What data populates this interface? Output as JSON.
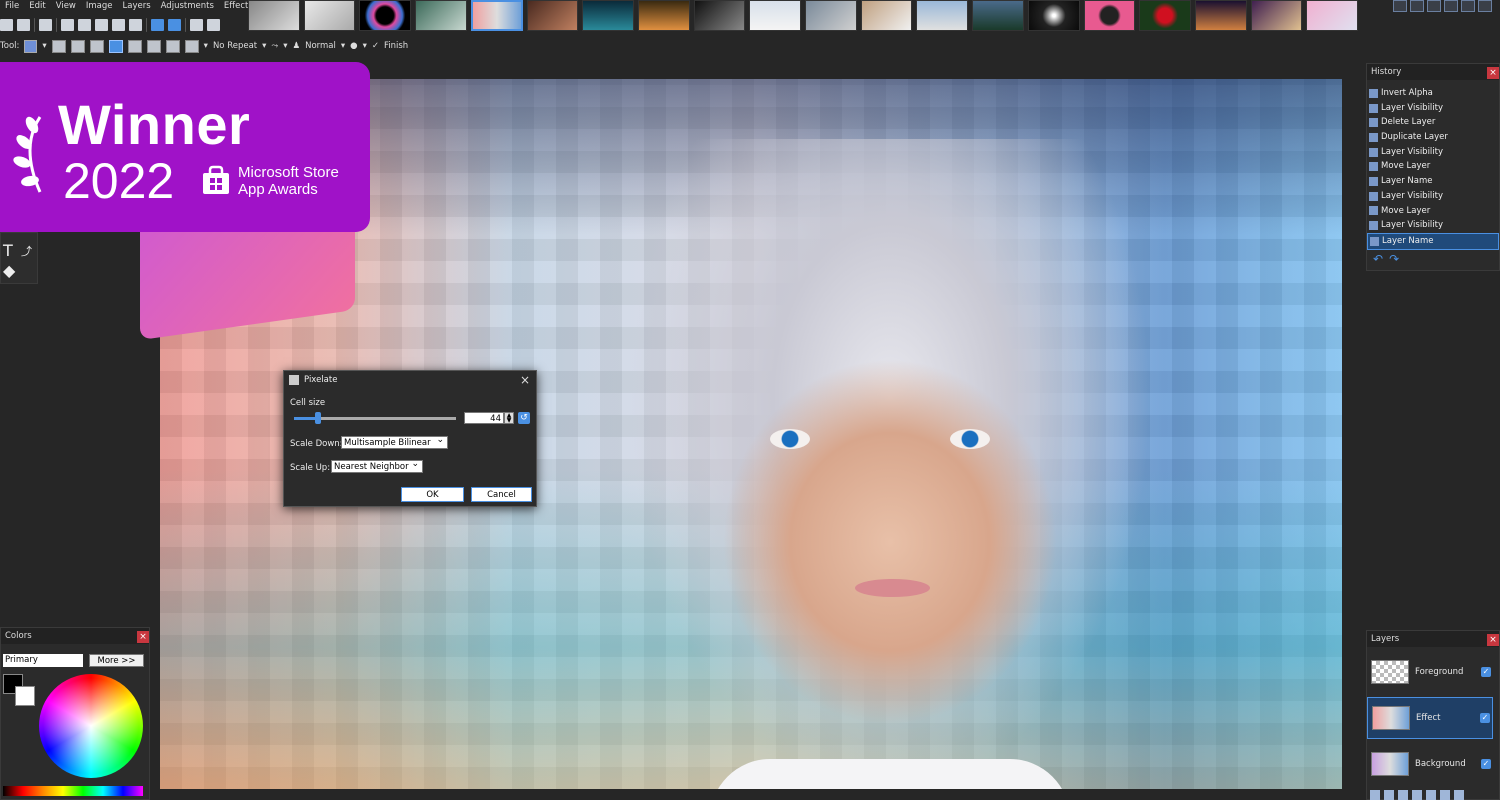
{
  "menu": [
    "File",
    "Edit",
    "View",
    "Image",
    "Layers",
    "Adjustments",
    "Effects"
  ],
  "toolbar": {
    "tool_label": "Tool:",
    "tiling": "No Repeat",
    "blend_mode": "Normal",
    "finish": "Finish"
  },
  "award": {
    "winner": "Winner",
    "year": "2022",
    "line1": "Microsoft Store",
    "line2": "App Awards"
  },
  "history": {
    "title": "History",
    "items": [
      "Invert Alpha",
      "Layer Visibility",
      "Delete Layer",
      "Duplicate Layer",
      "Layer Visibility",
      "Move Layer",
      "Layer Name",
      "Layer Visibility",
      "Move Layer",
      "Layer Visibility",
      "Layer Name"
    ],
    "selected_index": 10
  },
  "layers": {
    "title": "Layers",
    "items": [
      "Foreground",
      "Effect",
      "Background"
    ],
    "selected_index": 1
  },
  "colors": {
    "title": "Colors",
    "mode": "Primary",
    "more": "More >>",
    "primary": "#000000",
    "secondary": "#ffffff"
  },
  "dialog": {
    "title": "Pixelate",
    "cell_size_label": "Cell size",
    "cell_size": "44",
    "cell_size_fraction": 0.15,
    "scale_down_label": "Scale Down:",
    "scale_down": "Multisample Bilinear",
    "scale_up_label": "Scale Up:",
    "scale_up": "Nearest Neighbor",
    "ok": "OK",
    "cancel": "Cancel"
  },
  "accent": "#4a90e2"
}
